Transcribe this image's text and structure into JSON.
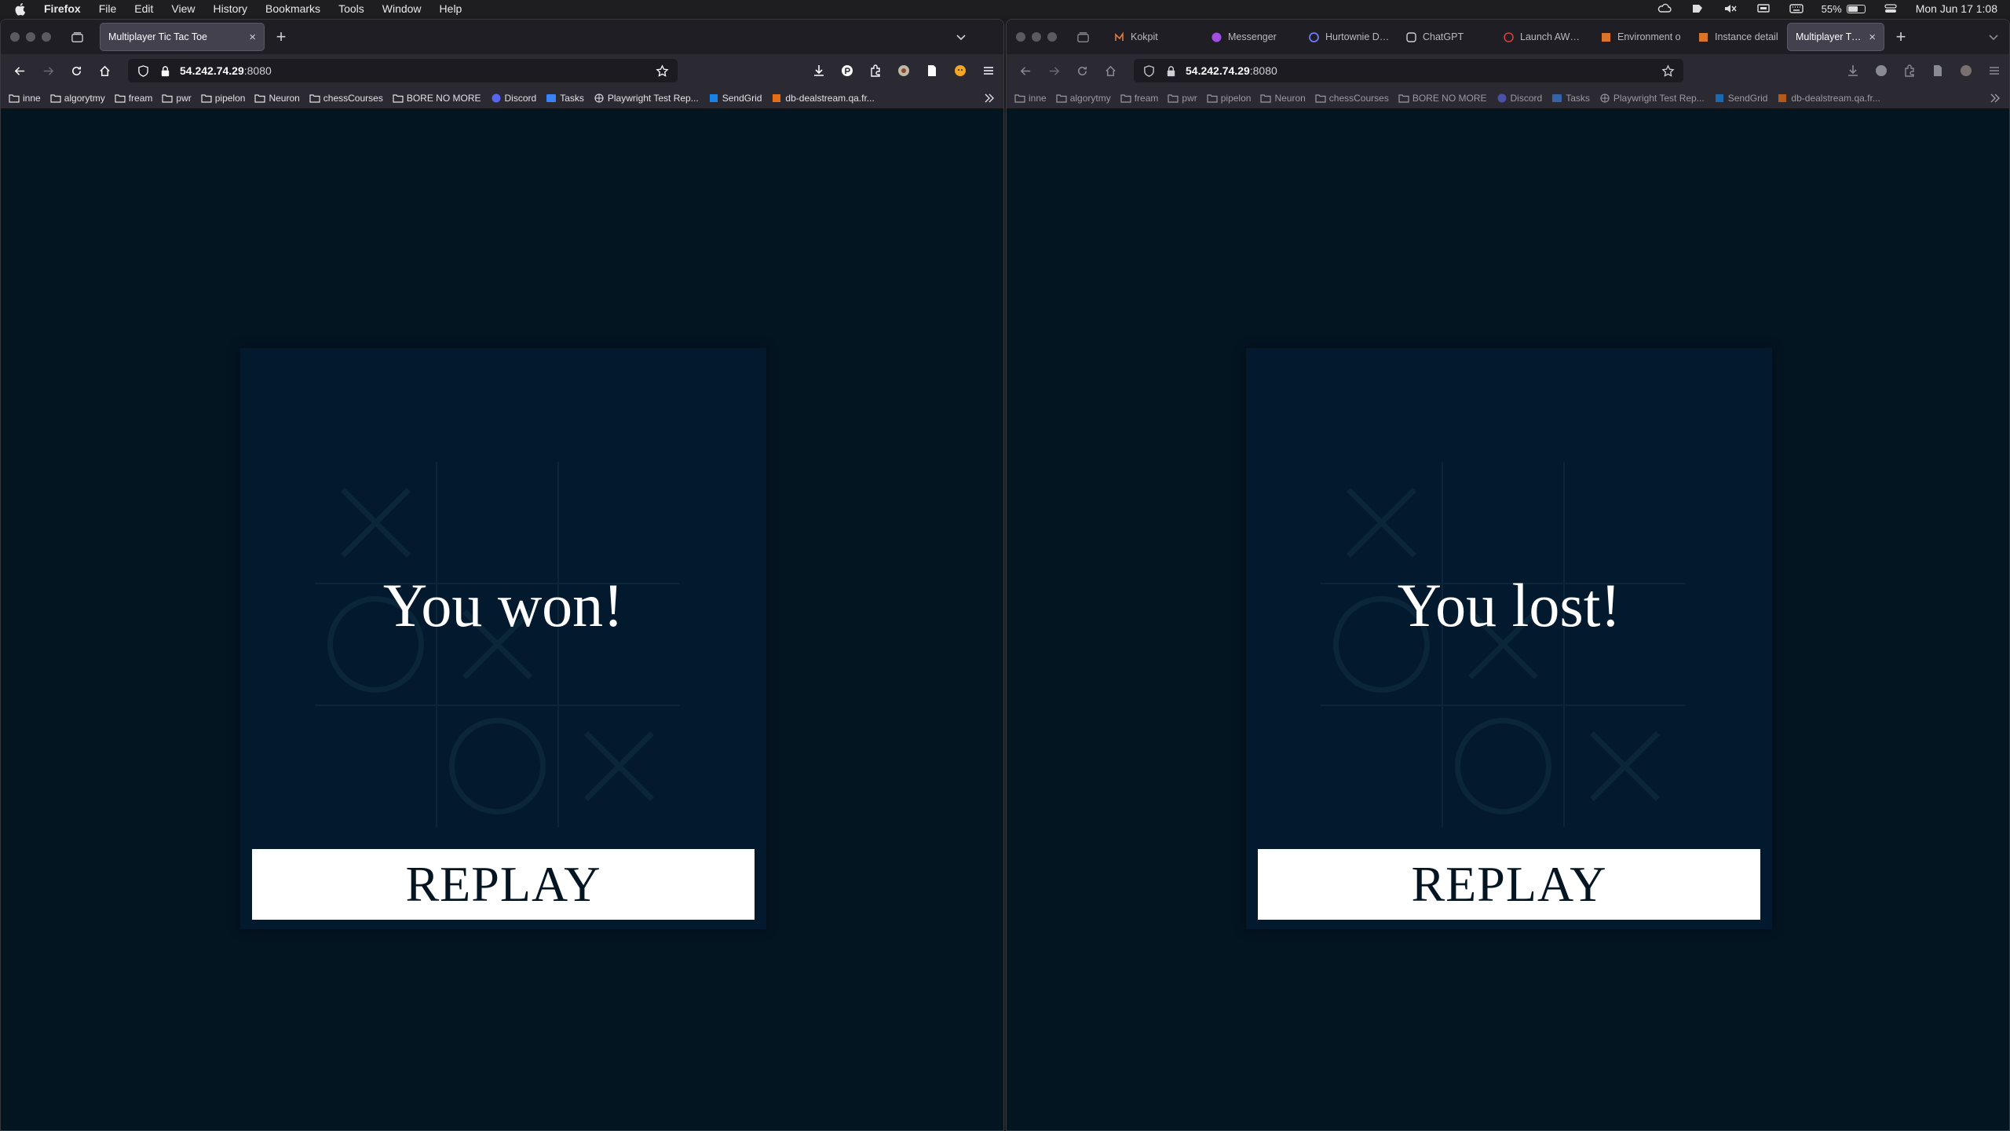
{
  "menubar": {
    "app": "Firefox",
    "items": [
      "File",
      "Edit",
      "View",
      "History",
      "Bookmarks",
      "Tools",
      "Window",
      "Help"
    ],
    "battery": "55%",
    "clock": "Mon Jun 17  1:08"
  },
  "left_window": {
    "tabs": [
      {
        "label": "Multiplayer Tic Tac Toe",
        "active": true
      }
    ],
    "url_host": "54.242.74.29",
    "url_port": ":8080",
    "bookmarks": [
      "inne",
      "algorytmy",
      "fream",
      "pwr",
      "pipelon",
      "Neuron",
      "chessCourses",
      "BORE NO MORE",
      "Discord",
      "Tasks",
      "Playwright Test Rep...",
      "SendGrid",
      "db-dealstream.qa.fr..."
    ],
    "game": {
      "result": "You won!",
      "button": "REPLAY"
    }
  },
  "right_window": {
    "tabs": [
      {
        "label": "Kokpit",
        "active": false
      },
      {
        "label": "Messenger",
        "active": false
      },
      {
        "label": "Hurtownie Dan",
        "active": false
      },
      {
        "label": "ChatGPT",
        "active": false
      },
      {
        "label": "Launch AWS A",
        "active": false
      },
      {
        "label": "Environment o",
        "active": false
      },
      {
        "label": "Instance detail",
        "active": false
      },
      {
        "label": "Multiplayer Tic T",
        "active": true
      }
    ],
    "url_host": "54.242.74.29",
    "url_port": ":8080",
    "bookmarks": [
      "inne",
      "algorytmy",
      "fream",
      "pwr",
      "pipelon",
      "Neuron",
      "chessCourses",
      "BORE NO MORE",
      "Discord",
      "Tasks",
      "Playwright Test Rep...",
      "SendGrid",
      "db-dealstream.qa.fr..."
    ],
    "game": {
      "result": "You lost!",
      "button": "REPLAY"
    }
  },
  "board_marks": [
    "X",
    "",
    "",
    "O",
    "X",
    "",
    "",
    "O",
    "X"
  ],
  "colors": {
    "background": "#041522",
    "card": "#031a2e",
    "board_lines": "#0b2638",
    "button_bg": "#ffffff",
    "button_text": "#041522"
  }
}
